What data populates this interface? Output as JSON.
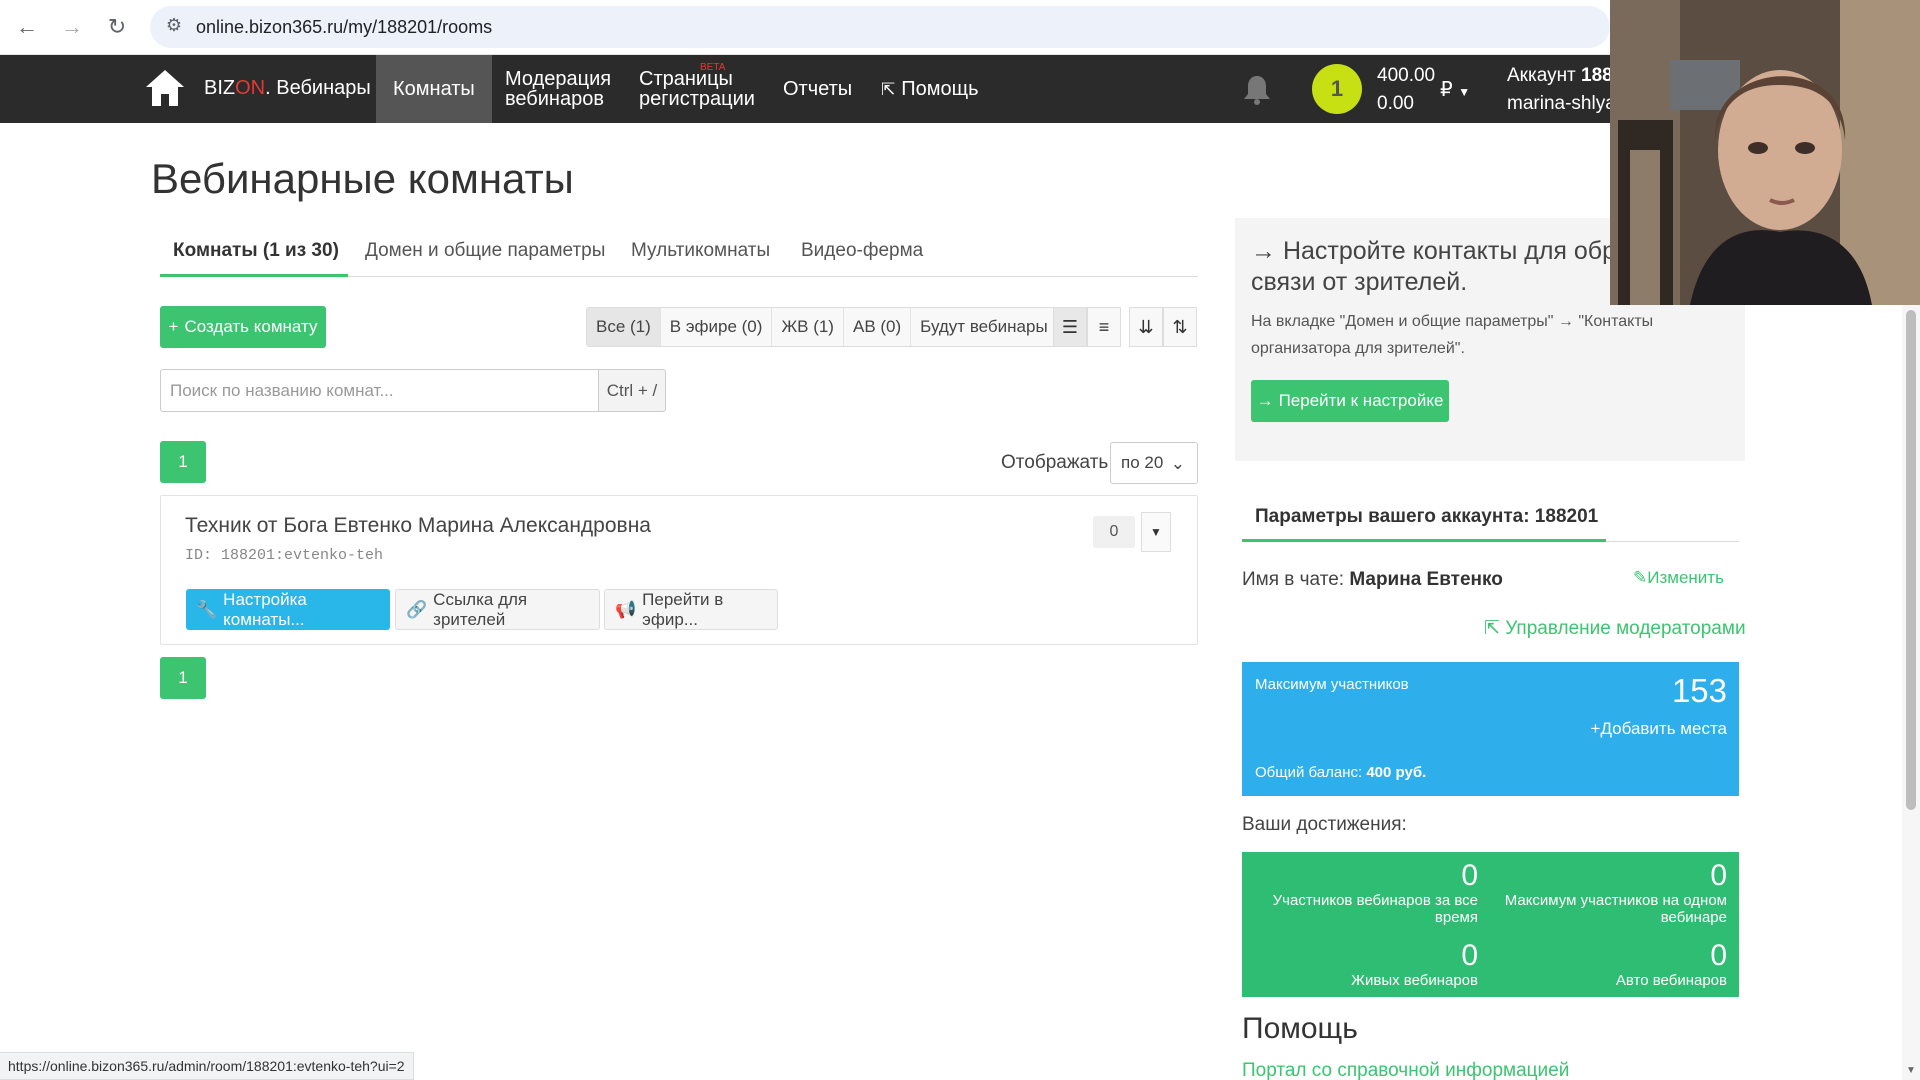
{
  "browser": {
    "url": "online.bizon365.ru/my/188201/rooms",
    "status_url": "https://online.bizon365.ru/admin/room/188201:evtenko-teh?ui=2"
  },
  "nav": {
    "brand_prefix": "BIZ",
    "brand_on": "ON",
    "brand_suffix": ". Вебинары",
    "items": [
      "Комнаты",
      "Модерация вебинаров",
      "Страницы регистрации",
      "Отчеты",
      "Помощь"
    ],
    "beta": "BETA",
    "coin": "1",
    "balance1": "400.00",
    "balance2": "0.00",
    "currency": "₽",
    "account_label": "Аккаунт",
    "account_id": "188",
    "account_user": "marina-shlya"
  },
  "page": {
    "title": "Вебинарные комнаты",
    "tabs": [
      "Комнаты (1 из 30)",
      "Домен и общие параметры",
      "Мультикомнаты",
      "Видео-ферма"
    ],
    "create_button": "Создать комнату",
    "filters": [
      "Все (1)",
      "В эфире (0)",
      "ЖВ (1)",
      "АВ (0)",
      "Будут вебинары (1)"
    ],
    "search_placeholder": "Поиск по названию комнат...",
    "search_shortcut": "Ctrl + /",
    "page_number": "1",
    "show_label": "Отображать",
    "show_value": "по 20"
  },
  "room": {
    "name": "Техник от Бога Евтенко Марина Александровна",
    "id": "ID: 188201:evtenko-teh",
    "count": "0",
    "btn_settings": "Настройка комнаты...",
    "btn_link": "Ссылка для зрителей",
    "btn_live": "Перейти в эфир..."
  },
  "sidebar": {
    "promo_title_line1": "Настройте контакты для обр",
    "promo_title_line2": "связи от зрителей.",
    "promo_text": "На вкладке \"Домен и общие параметры\" → \"Контакты организатора для зрителей\".",
    "promo_button": "Перейти к настройке",
    "account_tab": "Параметры вашего аккаунта: 188201",
    "chat_name_label": "Имя в чате:",
    "chat_name_value": "Марина Евтенко",
    "edit_link": "Изменить",
    "moderators_link": "Управление модераторами",
    "max_label": "Максимум участников",
    "max_value": "153",
    "add_seats": "+Добавить места",
    "balance_label": "Общий баланс:",
    "balance_value": "400 руб.",
    "achievements_label": "Ваши достижения:",
    "achievements": [
      {
        "value": "0",
        "caption": "Участников вебинаров за все время"
      },
      {
        "value": "0",
        "caption": "Максимум участников на одном вебинаре"
      },
      {
        "value": "0",
        "caption": "Живых вебинаров"
      },
      {
        "value": "0",
        "caption": "Авто вебинаров"
      }
    ],
    "help_title": "Помощь",
    "help_link": "Портал со справочной информацией"
  },
  "colors": {
    "green": "#3cc470",
    "blue": "#2eaeeb",
    "nav_bg": "#2b2b2b",
    "achievements_bg": "#2ebd72"
  }
}
